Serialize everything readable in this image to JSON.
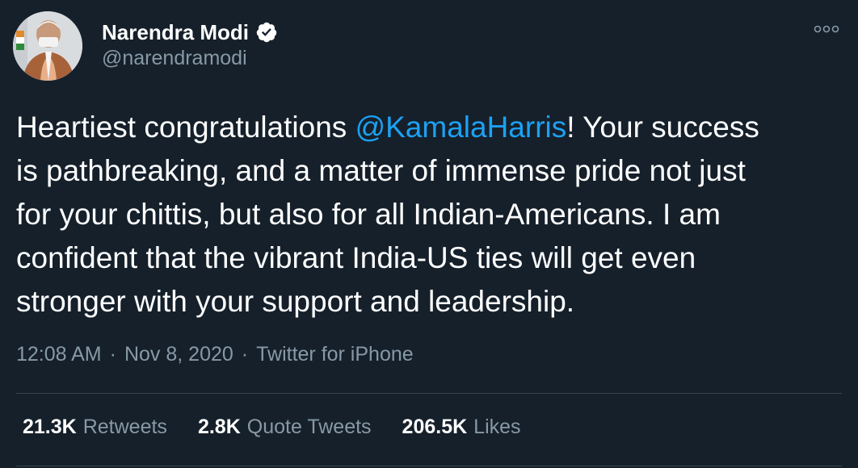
{
  "user": {
    "display_name": "Narendra Modi",
    "handle": "@narendramodi",
    "verified": true
  },
  "tweet": {
    "lines": [
      [
        "Heartiest congratulations ",
        "@KamalaHarris",
        "! Your success"
      ],
      [
        "is pathbreaking, and a matter of immense pride not just"
      ],
      [
        "for your chittis, but also for all Indian-Americans. I am"
      ],
      [
        "confident that the vibrant India-US ties will get even"
      ],
      [
        "stronger with your support and leadership."
      ]
    ]
  },
  "meta": {
    "time": "12:08 AM",
    "separator": "·",
    "date": "Nov 8, 2020",
    "source": "Twitter for iPhone"
  },
  "stats": {
    "retweets_count": "21.3K",
    "retweets_label": "Retweets",
    "quote_count": "2.8K",
    "quote_label": "Quote Tweets",
    "likes_count": "206.5K",
    "likes_label": "Likes"
  },
  "icons": {
    "verified": "verified-badge-icon",
    "more": "more-options-icon"
  },
  "colors": {
    "background": "#15202b",
    "text": "#ffffff",
    "secondary": "#8899a6",
    "link": "#1da1f2",
    "divider": "#38444d"
  }
}
